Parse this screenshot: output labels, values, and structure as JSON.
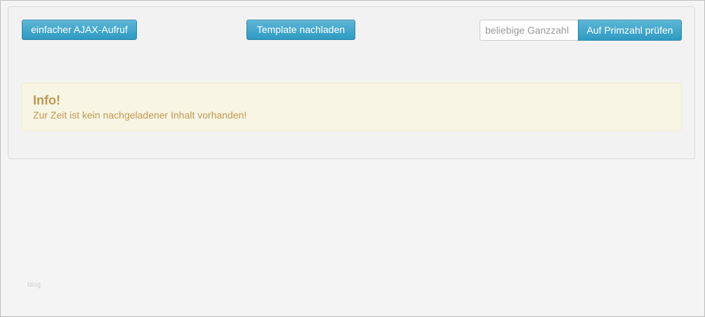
{
  "toolbar": {
    "ajax_button_label": "einfacher AJAX-Aufruf",
    "template_button_label": "Template nachladen",
    "prime_input_placeholder": "beliebige Ganzzahl",
    "prime_input_value": "",
    "prime_button_label": "Auf Primzahl prüfen"
  },
  "alert": {
    "title": "Info!",
    "message": "Zur Zeit ist kein nachgeladener Inhalt vorhanden!"
  },
  "footer": {
    "text": "blog"
  },
  "colors": {
    "page_background": "#f4f4f4",
    "well_background": "#f2f2f2",
    "button_blue": "#2f9bc2",
    "alert_background": "#f7f5e3",
    "alert_text": "#c09853"
  }
}
